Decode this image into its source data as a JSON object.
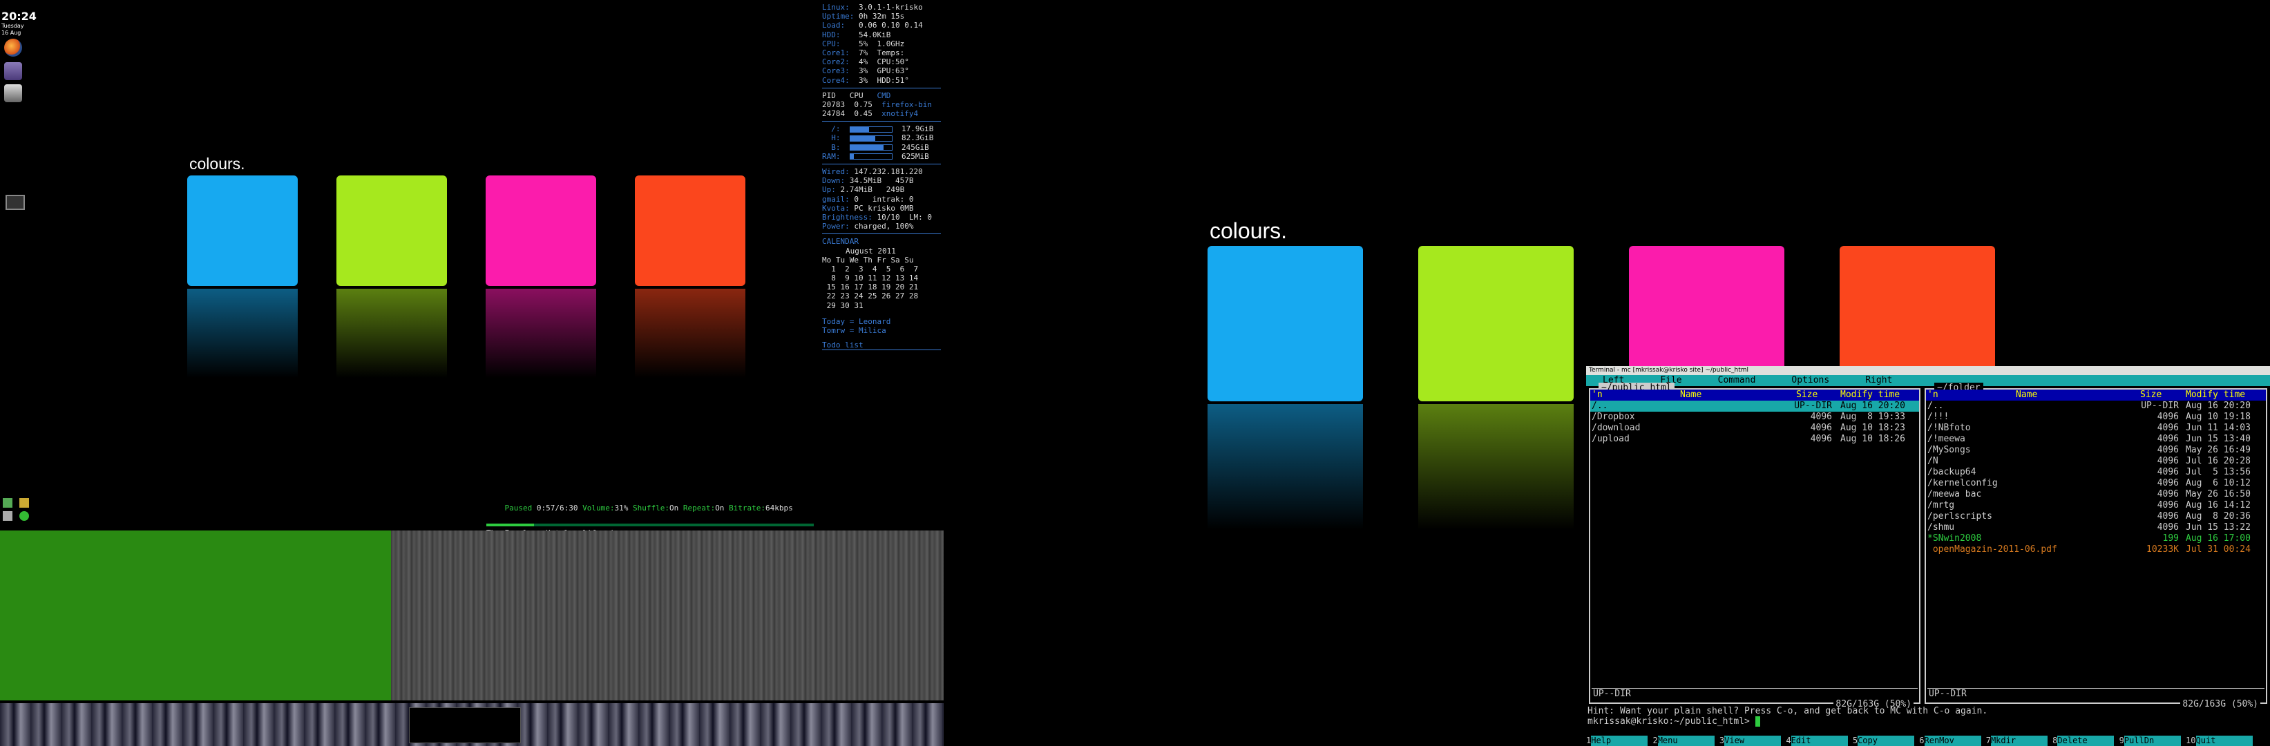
{
  "clock": {
    "time": "20:24",
    "day": "Tuesday",
    "date": "16 Aug"
  },
  "dock": {
    "icons": [
      "firefox-icon",
      "app-icon",
      "avatar-icon",
      "terminal-icon"
    ]
  },
  "wallpaper": {
    "title": "colours.",
    "colors": [
      "#17a9f0",
      "#a6e81e",
      "#fb1cac",
      "#fb461d"
    ]
  },
  "conky": {
    "lines": [
      {
        "k": "Linux:",
        "v": "3.0.1-1-krisko"
      },
      {
        "k": "Uptime:",
        "v": "0h 32m 15s"
      },
      {
        "k": "Load:",
        "v": "0.06 0.10 0.14"
      },
      {
        "k": "HDD:",
        "v": "54.0KiB"
      },
      {
        "k": "CPU:",
        "v": "5%  1.0GHz"
      },
      {
        "k": "Core1:",
        "v": "7%  Temps:"
      },
      {
        "k": "Core2:",
        "v": "4%  CPU:50°"
      },
      {
        "k": "Core3:",
        "v": "3%  GPU:63°"
      },
      {
        "k": "Core4:",
        "v": "3%  HDD:51°"
      }
    ],
    "procs": {
      "header": [
        "PID",
        "CPU",
        "CMD"
      ],
      "rows": [
        [
          "20783",
          "0.75",
          "firefox-bin"
        ],
        [
          "24784",
          "0.45",
          "xnotify4"
        ]
      ]
    },
    "disks": [
      {
        "k": "/:",
        "v": "17.9GiB",
        "f": 0.45
      },
      {
        "k": "H:",
        "v": "82.3GiB",
        "f": 0.6
      },
      {
        "k": "B:",
        "v": "245GiB",
        "f": 0.8
      },
      {
        "k": "RAM:",
        "v": "625MiB",
        "f": 0.08
      }
    ],
    "net": [
      {
        "k": "Wired:",
        "v": "147.232.181.220"
      },
      {
        "k": "Down:",
        "v": "34.5MiB   457B"
      },
      {
        "k": "Up:",
        "v": "2.74MiB   249B"
      },
      {
        "k": "gmail:",
        "v": "0   intrak: 0"
      },
      {
        "k": "Kvota:",
        "v": "PC krisko 0MB"
      },
      {
        "k": "Brightness:",
        "v": "10/10  LM: 0"
      },
      {
        "k": "Power:",
        "v": "charged, 100%"
      }
    ],
    "calendar": {
      "label": "CALENDAR",
      "month": "August 2011",
      "head": "Mo Tu We Th Fr Sa Su",
      "weeks": [
        " 1  2  3  4  5  6  7",
        " 8  9 10 11 12 13 14",
        "15 16 17 18 19 20 21",
        "22 23 24 25 26 27 28",
        "29 30 31"
      ]
    },
    "today": "Today = Leonard",
    "tomorrow": "Tomrw = Milica",
    "todo": "Todo list"
  },
  "music": {
    "status": "Paused",
    "time": "0:57/6:30",
    "volume": "31%",
    "shuffle": "On",
    "repeat": "On",
    "bitrate": "64kbps",
    "track": "The Eagels - Hotel california",
    "progress": 0.146
  },
  "terminal": {
    "title": "Terminal - mc [mkrissak@krisko site] ~/public_html",
    "menu": [
      "Left",
      "File",
      "Command",
      "Options",
      "Right"
    ],
    "left": {
      "path": "~/public_html",
      "headers": [
        "'n",
        "Name",
        "Size",
        "Modify time"
      ],
      "rows": [
        [
          "/..",
          "",
          "UP--DIR",
          "Aug 16 20:20"
        ],
        [
          "/Dropbox",
          "",
          "4096",
          "Aug  8 19:33"
        ],
        [
          "/download",
          "",
          "4096",
          "Aug 10 18:23"
        ],
        [
          "/upload",
          "",
          "4096",
          "Aug 10 18:26"
        ]
      ],
      "status": "UP--DIR",
      "free": "82G/163G (50%)"
    },
    "right": {
      "path": "~/folder",
      "headers": [
        "'n",
        "Name",
        "Size",
        "Modify time"
      ],
      "rows": [
        [
          "/..",
          "",
          "UP--DIR",
          "Aug 16 20:20"
        ],
        [
          "/!!!",
          "",
          "4096",
          "Aug 10 19:18"
        ],
        [
          "/!NBfoto",
          "",
          "4096",
          "Jun 11 14:03"
        ],
        [
          "/!meewa",
          "",
          "4096",
          "Jun 15 13:40"
        ],
        [
          "/MySongs",
          "",
          "4096",
          "May 26 16:49"
        ],
        [
          "/N",
          "",
          "4096",
          "Jul 16 20:28"
        ],
        [
          "/backup64",
          "",
          "4096",
          "Jul  5 13:56"
        ],
        [
          "/kernelconfig",
          "",
          "4096",
          "Aug  6 10:12"
        ],
        [
          "/meewa bac",
          "",
          "4096",
          "May 26 16:50"
        ],
        [
          "/mrtg",
          "",
          "4096",
          "Aug 16 14:12"
        ],
        [
          "/perlscripts",
          "",
          "4096",
          "Aug  8 20:36"
        ],
        [
          "/shmu",
          "",
          "4096",
          "Jun 15 13:22"
        ],
        [
          "*SNwin2008",
          "",
          "199",
          "Aug 16 17:00"
        ],
        [
          " openMagazin-2011-06.pdf",
          "",
          "10233K",
          "Jul 31 00:24"
        ]
      ],
      "status": "UP--DIR",
      "free": "82G/163G (50%)"
    },
    "hint": "Hint: Want your plain shell? Press C-o, and get back to MC with C-o again.",
    "prompt": "mkrissak@krisko:~/public_html> ",
    "fkeys": [
      [
        "1",
        "Help"
      ],
      [
        "2",
        "Menu"
      ],
      [
        "3",
        "View"
      ],
      [
        "4",
        "Edit"
      ],
      [
        "5",
        "Copy"
      ],
      [
        "6",
        "RenMov"
      ],
      [
        "7",
        "Mkdir"
      ],
      [
        "8",
        "Delete"
      ],
      [
        "9",
        "PullDn"
      ],
      [
        "10",
        "Quit"
      ]
    ]
  }
}
